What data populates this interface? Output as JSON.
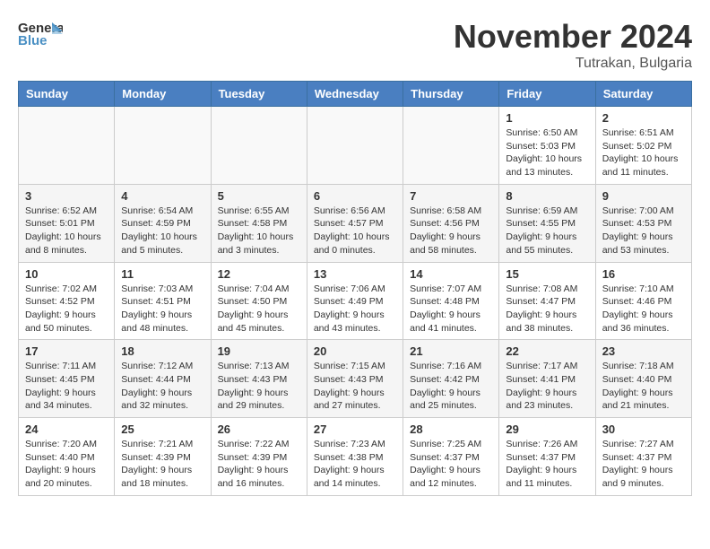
{
  "logo": {
    "general": "General",
    "blue": "Blue"
  },
  "title": "November 2024",
  "location": "Tutrakan, Bulgaria",
  "days_of_week": [
    "Sunday",
    "Monday",
    "Tuesday",
    "Wednesday",
    "Thursday",
    "Friday",
    "Saturday"
  ],
  "weeks": [
    {
      "days": [
        {
          "num": "",
          "info": ""
        },
        {
          "num": "",
          "info": ""
        },
        {
          "num": "",
          "info": ""
        },
        {
          "num": "",
          "info": ""
        },
        {
          "num": "",
          "info": ""
        },
        {
          "num": "1",
          "info": "Sunrise: 6:50 AM\nSunset: 5:03 PM\nDaylight: 10 hours and 13 minutes."
        },
        {
          "num": "2",
          "info": "Sunrise: 6:51 AM\nSunset: 5:02 PM\nDaylight: 10 hours and 11 minutes."
        }
      ]
    },
    {
      "days": [
        {
          "num": "3",
          "info": "Sunrise: 6:52 AM\nSunset: 5:01 PM\nDaylight: 10 hours and 8 minutes."
        },
        {
          "num": "4",
          "info": "Sunrise: 6:54 AM\nSunset: 4:59 PM\nDaylight: 10 hours and 5 minutes."
        },
        {
          "num": "5",
          "info": "Sunrise: 6:55 AM\nSunset: 4:58 PM\nDaylight: 10 hours and 3 minutes."
        },
        {
          "num": "6",
          "info": "Sunrise: 6:56 AM\nSunset: 4:57 PM\nDaylight: 10 hours and 0 minutes."
        },
        {
          "num": "7",
          "info": "Sunrise: 6:58 AM\nSunset: 4:56 PM\nDaylight: 9 hours and 58 minutes."
        },
        {
          "num": "8",
          "info": "Sunrise: 6:59 AM\nSunset: 4:55 PM\nDaylight: 9 hours and 55 minutes."
        },
        {
          "num": "9",
          "info": "Sunrise: 7:00 AM\nSunset: 4:53 PM\nDaylight: 9 hours and 53 minutes."
        }
      ]
    },
    {
      "days": [
        {
          "num": "10",
          "info": "Sunrise: 7:02 AM\nSunset: 4:52 PM\nDaylight: 9 hours and 50 minutes."
        },
        {
          "num": "11",
          "info": "Sunrise: 7:03 AM\nSunset: 4:51 PM\nDaylight: 9 hours and 48 minutes."
        },
        {
          "num": "12",
          "info": "Sunrise: 7:04 AM\nSunset: 4:50 PM\nDaylight: 9 hours and 45 minutes."
        },
        {
          "num": "13",
          "info": "Sunrise: 7:06 AM\nSunset: 4:49 PM\nDaylight: 9 hours and 43 minutes."
        },
        {
          "num": "14",
          "info": "Sunrise: 7:07 AM\nSunset: 4:48 PM\nDaylight: 9 hours and 41 minutes."
        },
        {
          "num": "15",
          "info": "Sunrise: 7:08 AM\nSunset: 4:47 PM\nDaylight: 9 hours and 38 minutes."
        },
        {
          "num": "16",
          "info": "Sunrise: 7:10 AM\nSunset: 4:46 PM\nDaylight: 9 hours and 36 minutes."
        }
      ]
    },
    {
      "days": [
        {
          "num": "17",
          "info": "Sunrise: 7:11 AM\nSunset: 4:45 PM\nDaylight: 9 hours and 34 minutes."
        },
        {
          "num": "18",
          "info": "Sunrise: 7:12 AM\nSunset: 4:44 PM\nDaylight: 9 hours and 32 minutes."
        },
        {
          "num": "19",
          "info": "Sunrise: 7:13 AM\nSunset: 4:43 PM\nDaylight: 9 hours and 29 minutes."
        },
        {
          "num": "20",
          "info": "Sunrise: 7:15 AM\nSunset: 4:43 PM\nDaylight: 9 hours and 27 minutes."
        },
        {
          "num": "21",
          "info": "Sunrise: 7:16 AM\nSunset: 4:42 PM\nDaylight: 9 hours and 25 minutes."
        },
        {
          "num": "22",
          "info": "Sunrise: 7:17 AM\nSunset: 4:41 PM\nDaylight: 9 hours and 23 minutes."
        },
        {
          "num": "23",
          "info": "Sunrise: 7:18 AM\nSunset: 4:40 PM\nDaylight: 9 hours and 21 minutes."
        }
      ]
    },
    {
      "days": [
        {
          "num": "24",
          "info": "Sunrise: 7:20 AM\nSunset: 4:40 PM\nDaylight: 9 hours and 20 minutes."
        },
        {
          "num": "25",
          "info": "Sunrise: 7:21 AM\nSunset: 4:39 PM\nDaylight: 9 hours and 18 minutes."
        },
        {
          "num": "26",
          "info": "Sunrise: 7:22 AM\nSunset: 4:39 PM\nDaylight: 9 hours and 16 minutes."
        },
        {
          "num": "27",
          "info": "Sunrise: 7:23 AM\nSunset: 4:38 PM\nDaylight: 9 hours and 14 minutes."
        },
        {
          "num": "28",
          "info": "Sunrise: 7:25 AM\nSunset: 4:37 PM\nDaylight: 9 hours and 12 minutes."
        },
        {
          "num": "29",
          "info": "Sunrise: 7:26 AM\nSunset: 4:37 PM\nDaylight: 9 hours and 11 minutes."
        },
        {
          "num": "30",
          "info": "Sunrise: 7:27 AM\nSunset: 4:37 PM\nDaylight: 9 hours and 9 minutes."
        }
      ]
    }
  ]
}
